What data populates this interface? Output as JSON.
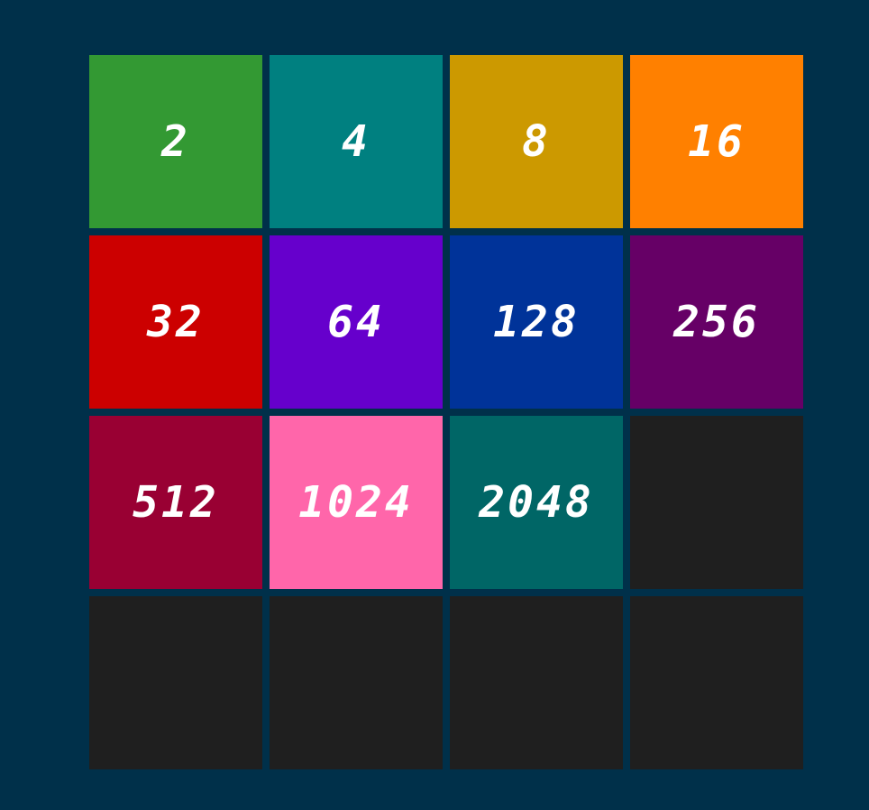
{
  "board": {
    "tiles": [
      {
        "value": "2",
        "color": "#339933"
      },
      {
        "value": "4",
        "color": "#008080"
      },
      {
        "value": "8",
        "color": "#cc9900"
      },
      {
        "value": "16",
        "color": "#ff8000"
      },
      {
        "value": "32",
        "color": "#cc0000"
      },
      {
        "value": "64",
        "color": "#6600cc"
      },
      {
        "value": "128",
        "color": "#003399"
      },
      {
        "value": "256",
        "color": "#660066"
      },
      {
        "value": "512",
        "color": "#990033"
      },
      {
        "value": "1024",
        "color": "#ff66aa"
      },
      {
        "value": "2048",
        "color": "#006666"
      },
      {
        "value": "",
        "color": "#1f1f1f"
      },
      {
        "value": "",
        "color": "#1f1f1f"
      },
      {
        "value": "",
        "color": "#1f1f1f"
      },
      {
        "value": "",
        "color": "#1f1f1f"
      },
      {
        "value": "",
        "color": "#1f1f1f"
      }
    ]
  }
}
